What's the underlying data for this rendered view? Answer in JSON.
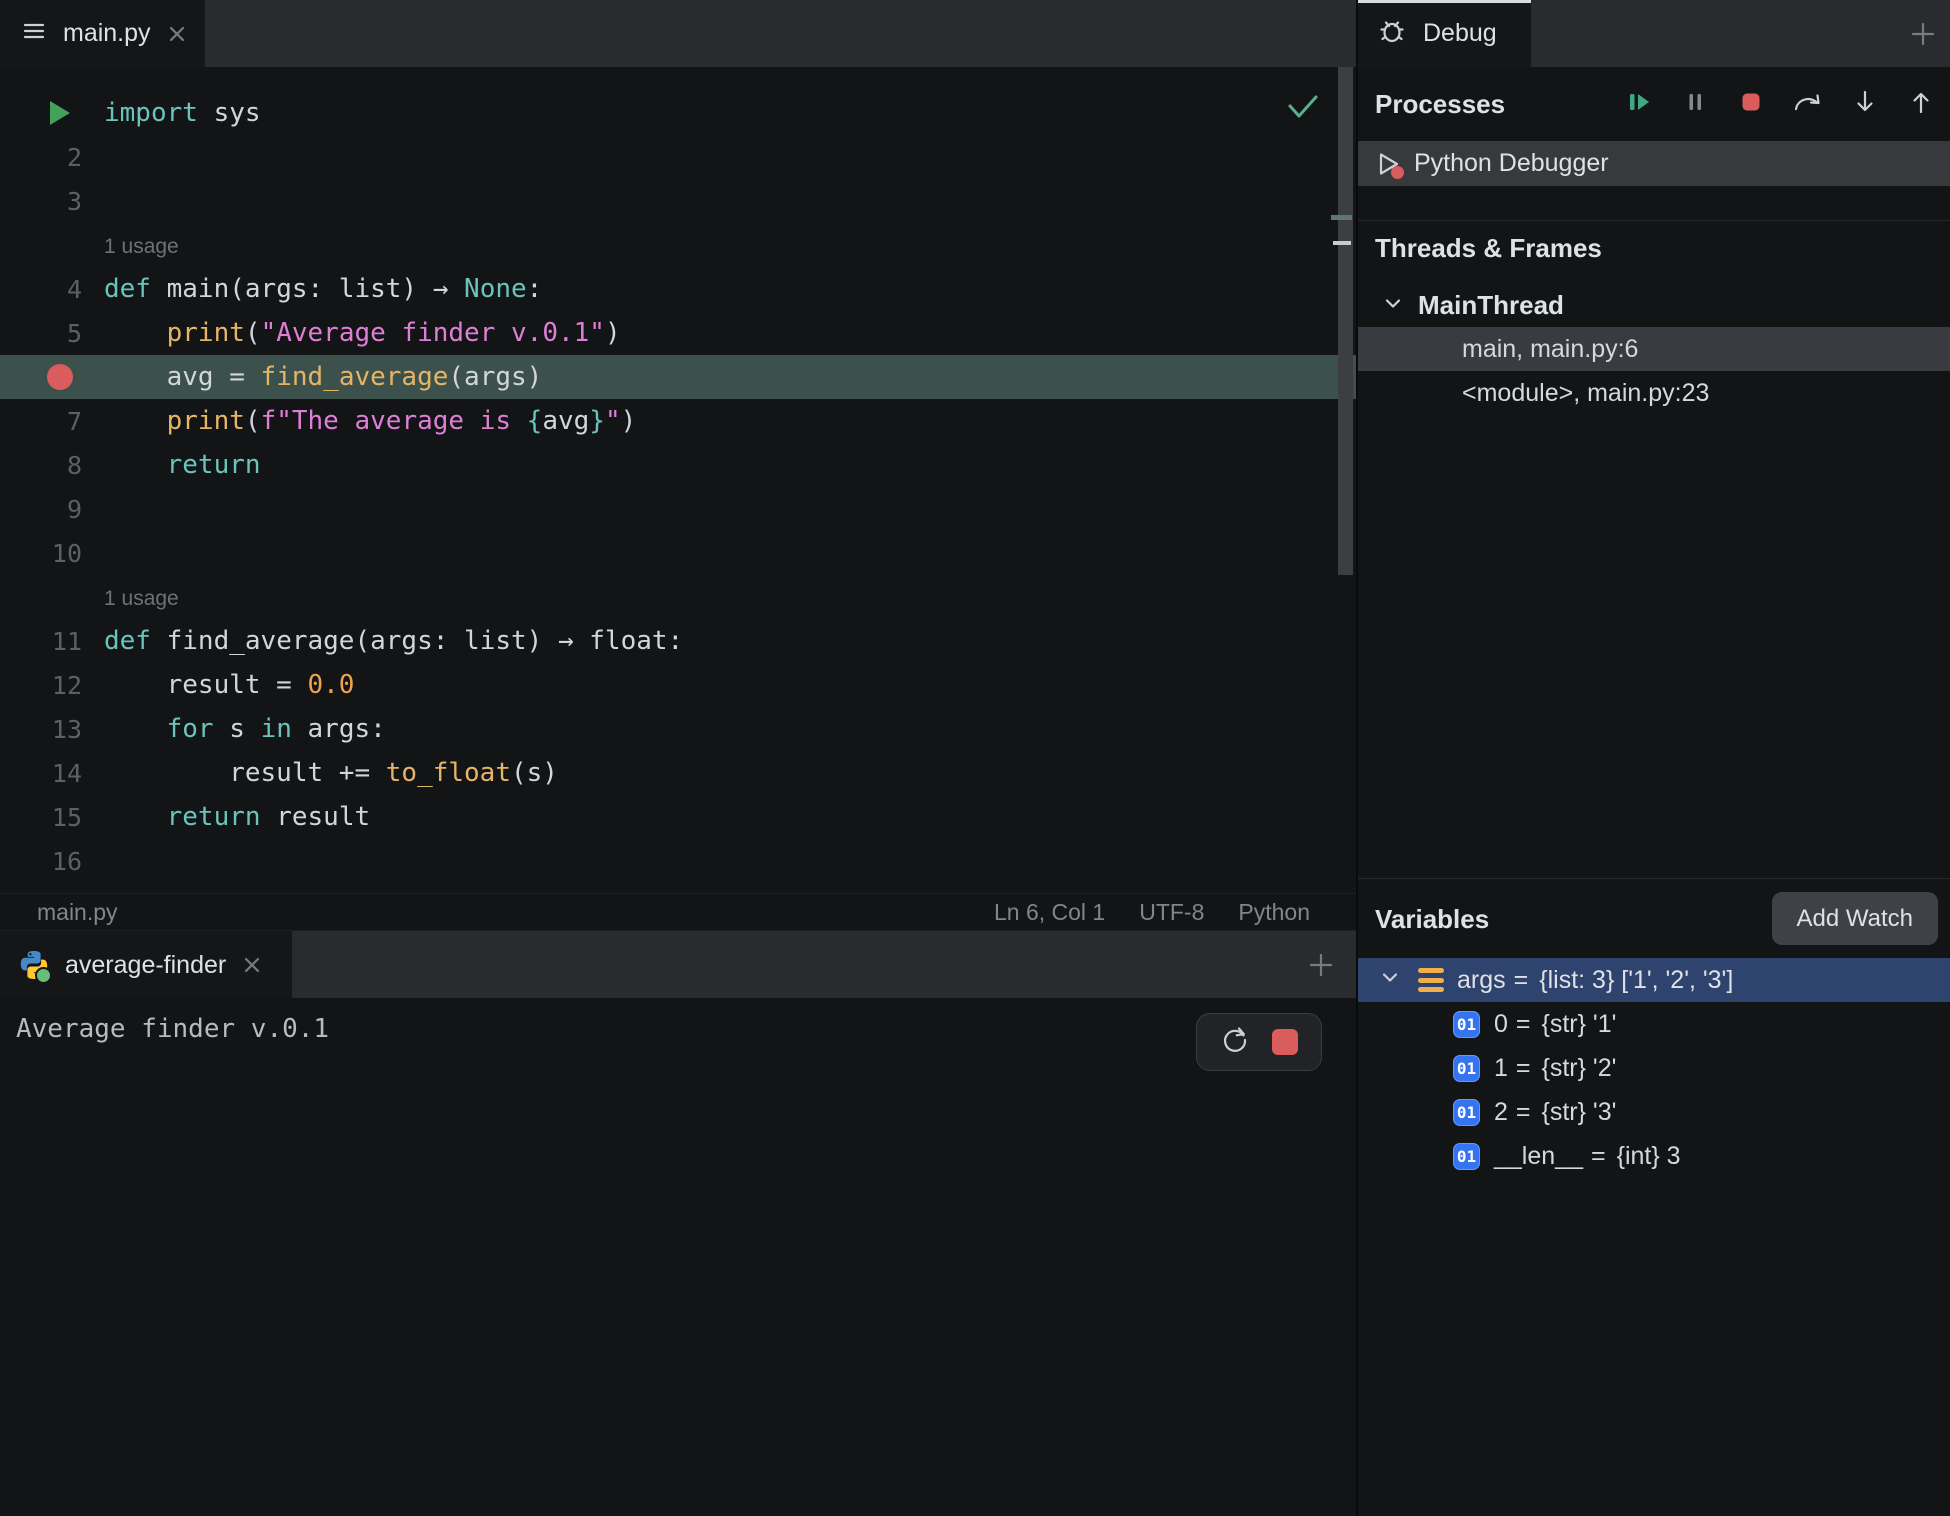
{
  "colors": {
    "accent_blue": "#3574F0",
    "selection_blue": "#2E436E",
    "selection_gray": "#393B40",
    "breakpoint_red": "#DB5C5C",
    "run_green": "#43A159",
    "resume_green": "#3EA885",
    "keyword_teal": "#69C4BC",
    "function_gold": "#E5B567",
    "string_pink": "#DE7FD6",
    "number_orange": "#EFA24E",
    "list_icon_orange": "#EFAF4C",
    "current_line_bg": "#3D514C"
  },
  "editor": {
    "tab_label": "main.py",
    "lines": [
      {
        "num": "",
        "run": true,
        "segs": [
          {
            "t": "import ",
            "c": "kw"
          },
          {
            "t": "sys",
            "c": "txt"
          }
        ]
      },
      {
        "num": "2",
        "segs": []
      },
      {
        "num": "3",
        "segs": []
      },
      {
        "hint": "1 usage"
      },
      {
        "num": "4",
        "segs": [
          {
            "t": "def ",
            "c": "kw"
          },
          {
            "t": "main(args: list) → ",
            "c": "txt"
          },
          {
            "t": "None",
            "c": "kw"
          },
          {
            "t": ":",
            "c": "txt"
          }
        ]
      },
      {
        "num": "5",
        "segs": [
          {
            "t": "    ",
            "c": "txt"
          },
          {
            "t": "print",
            "c": "fn"
          },
          {
            "t": "(",
            "c": "txt"
          },
          {
            "t": "\"Average finder v.0.1\"",
            "c": "str"
          },
          {
            "t": ")",
            "c": "txt"
          }
        ]
      },
      {
        "num": "",
        "breakpoint": true,
        "current": true,
        "segs": [
          {
            "t": "    avg = ",
            "c": "txt"
          },
          {
            "t": "find_average",
            "c": "fn"
          },
          {
            "t": "(args)",
            "c": "txt"
          }
        ]
      },
      {
        "num": "7",
        "segs": [
          {
            "t": "    ",
            "c": "txt"
          },
          {
            "t": "print",
            "c": "fn"
          },
          {
            "t": "(",
            "c": "txt"
          },
          {
            "t": "f\"The average is ",
            "c": "str"
          },
          {
            "t": "{",
            "c": "br"
          },
          {
            "t": "avg",
            "c": "txt"
          },
          {
            "t": "}",
            "c": "br"
          },
          {
            "t": "\"",
            "c": "str"
          },
          {
            "t": ")",
            "c": "txt"
          }
        ]
      },
      {
        "num": "8",
        "segs": [
          {
            "t": "    ",
            "c": "txt"
          },
          {
            "t": "return",
            "c": "kw"
          }
        ]
      },
      {
        "num": "9",
        "segs": []
      },
      {
        "num": "10",
        "segs": []
      },
      {
        "hint": "1 usage"
      },
      {
        "num": "11",
        "segs": [
          {
            "t": "def ",
            "c": "kw"
          },
          {
            "t": "find_average(args: list) → float:",
            "c": "txt"
          }
        ]
      },
      {
        "num": "12",
        "segs": [
          {
            "t": "    result = ",
            "c": "txt"
          },
          {
            "t": "0.0",
            "c": "num"
          }
        ]
      },
      {
        "num": "13",
        "segs": [
          {
            "t": "    ",
            "c": "txt"
          },
          {
            "t": "for",
            "c": "kw"
          },
          {
            "t": " s ",
            "c": "txt"
          },
          {
            "t": "in",
            "c": "kw"
          },
          {
            "t": " args:",
            "c": "txt"
          }
        ]
      },
      {
        "num": "14",
        "segs": [
          {
            "t": "        result += ",
            "c": "txt"
          },
          {
            "t": "to_float",
            "c": "fn"
          },
          {
            "t": "(s)",
            "c": "txt"
          }
        ]
      },
      {
        "num": "15",
        "segs": [
          {
            "t": "    ",
            "c": "txt"
          },
          {
            "t": "return",
            "c": "kw"
          },
          {
            "t": " result",
            "c": "txt"
          }
        ]
      },
      {
        "num": "16",
        "segs": []
      }
    ],
    "status": {
      "file": "main.py",
      "items": [
        "Ln 6, Col 1",
        "UTF-8",
        "Python"
      ]
    }
  },
  "console": {
    "tab_label": "average-finder",
    "output": "Average finder v.0.1"
  },
  "debug": {
    "tab_label": "Debug",
    "processes_label": "Processes",
    "process_label": "Python Debugger",
    "threads_header": "Threads & Frames",
    "thread_label": "MainThread",
    "frames": [
      {
        "label": "main, main.py:6",
        "selected": true
      },
      {
        "label": "<module>, main.py:23",
        "selected": false
      }
    ],
    "variables": {
      "header": "Variables",
      "add_watch_label": "Add Watch",
      "root": {
        "name": "args",
        "eq": "=",
        "value": "{list: 3} ['1', '2', '3']"
      },
      "children": [
        {
          "badge": "01",
          "name": "0",
          "eq": "=",
          "value": "{str} '1'"
        },
        {
          "badge": "01",
          "name": "1",
          "eq": "=",
          "value": "{str} '2'"
        },
        {
          "badge": "01",
          "name": "2",
          "eq": "=",
          "value": "{str} '3'"
        },
        {
          "badge": "01",
          "name": "__len__",
          "eq": "=",
          "value": "{int} 3"
        }
      ]
    }
  }
}
